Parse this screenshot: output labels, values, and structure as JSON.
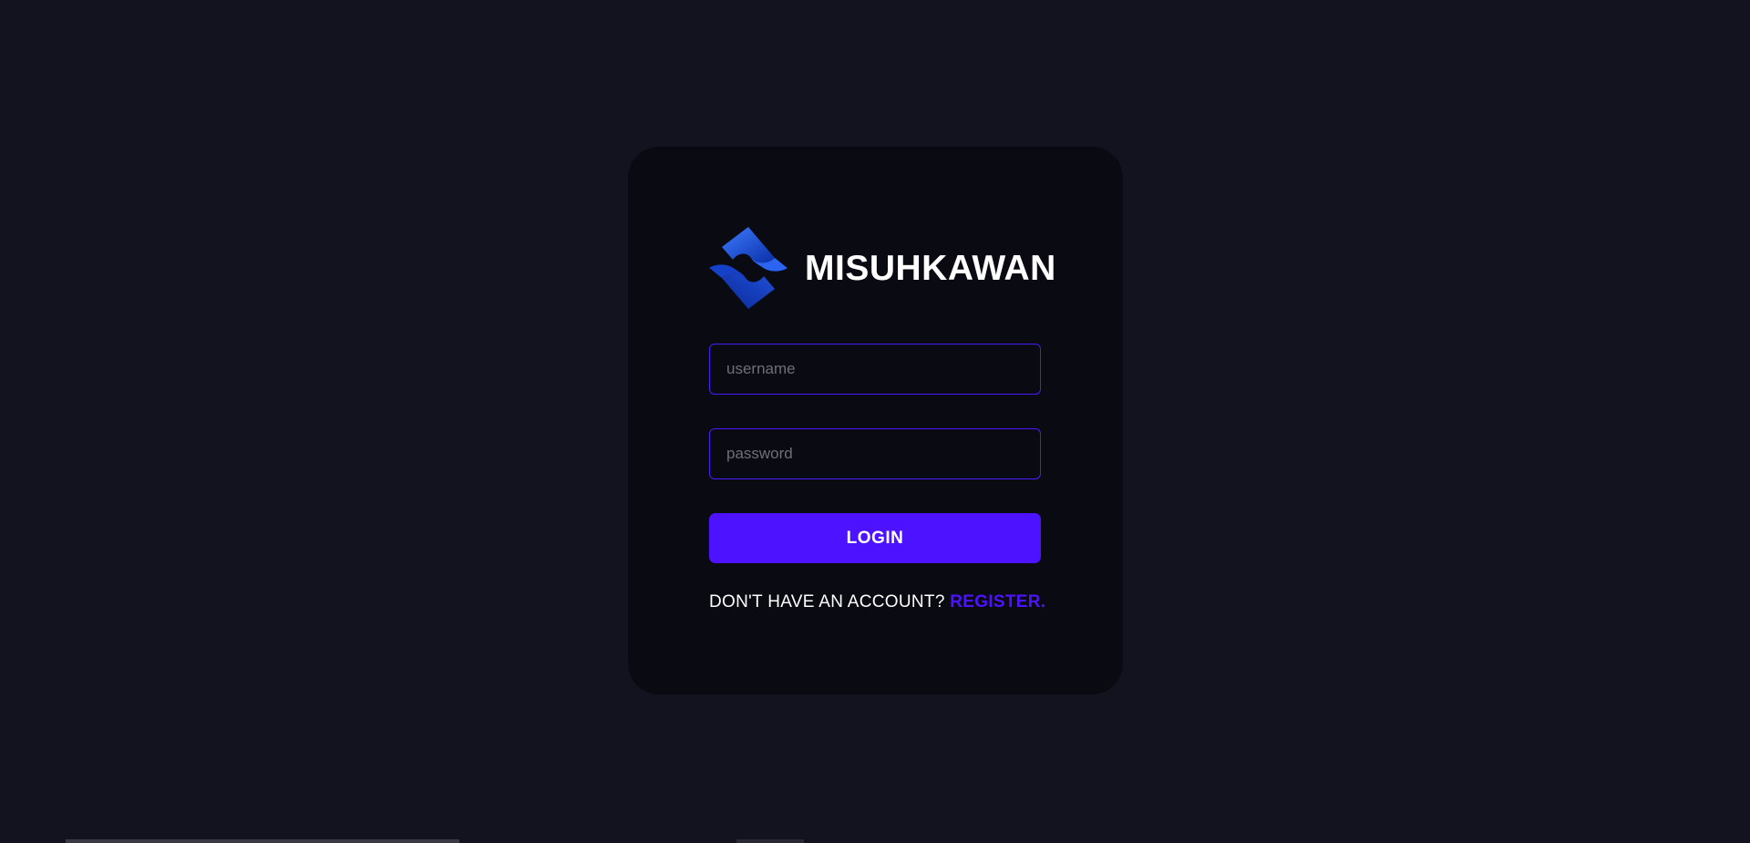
{
  "brand": {
    "name": "MISUHKAWAN",
    "logo_icon": "diamond-s-logo-icon",
    "logo_colors": [
      "#1f4fd6",
      "#0a2fa8",
      "#3d7bff"
    ]
  },
  "form": {
    "username_placeholder": "username",
    "password_placeholder": "password",
    "login_label": "LOGIN"
  },
  "register": {
    "prompt": "DON'T HAVE AN ACCOUNT? ",
    "link_label": "REGISTER."
  },
  "colors": {
    "background": "#131320",
    "card": "#0a0a12",
    "accent": "#4d12ff",
    "field_border": "#4a1bff"
  }
}
